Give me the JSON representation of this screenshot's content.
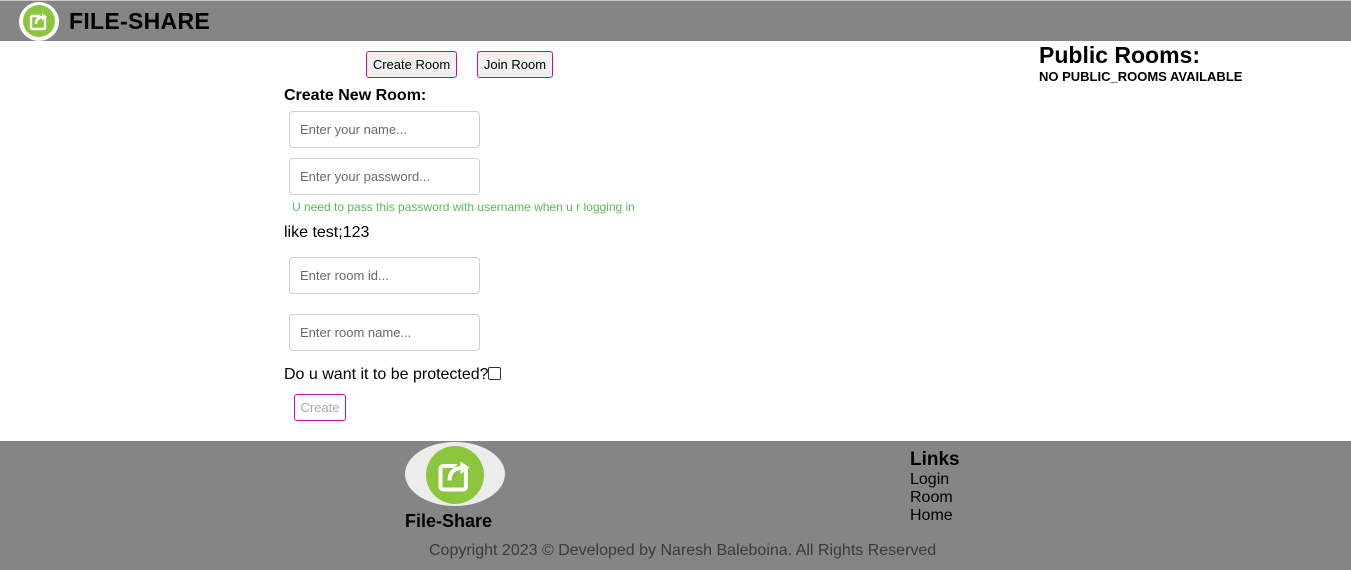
{
  "header": {
    "logo_icon": "share-icon",
    "title": "FILE-SHARE"
  },
  "tabs": {
    "create_room": "Create Room",
    "join_room": "Join Room"
  },
  "form": {
    "title": "Create New Room:",
    "name_placeholder": "Enter your name...",
    "password_placeholder": "Enter your password...",
    "password_hint": "U need to pass this password with username when u r logging in",
    "example": "like test;123",
    "room_id_placeholder": "Enter room id...",
    "room_name_placeholder": "Enter room name...",
    "protected_label": "Do u want it to be protected?",
    "protected_checked": false,
    "create_label": "Create"
  },
  "public_rooms": {
    "title": "Public Rooms:",
    "empty_message": "NO PUBLIC_ROOMS AVAILABLE"
  },
  "footer": {
    "logo_icon": "share-icon",
    "brand": "File-Share",
    "links_title": "Links",
    "links": [
      "Login",
      "Room",
      "Home"
    ],
    "copyright": "Copyright 2023 © Developed by Naresh Baleboina. All Rights Reserved"
  },
  "colors": {
    "bar_gray": "#858585",
    "accent_magenta": "#c0129a",
    "hint_green": "#5cb85c",
    "logo_green": "#8cc63e"
  }
}
